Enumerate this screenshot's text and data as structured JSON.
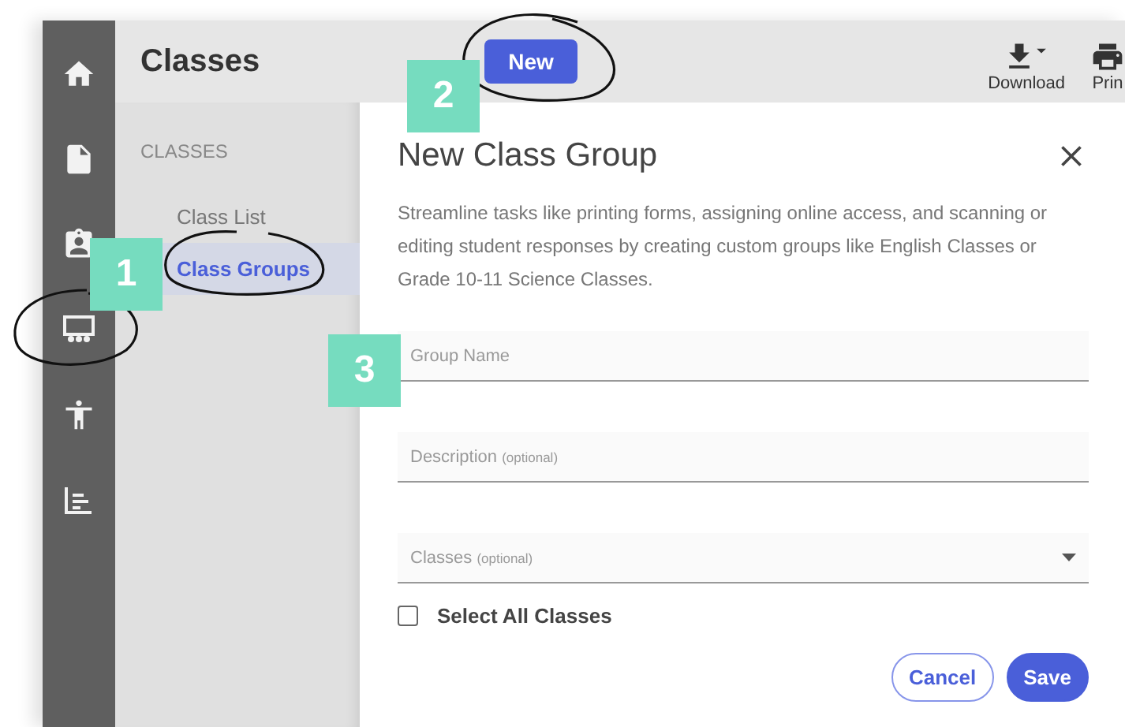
{
  "rail": {
    "items": [
      {
        "kind": "home"
      },
      {
        "kind": "file"
      },
      {
        "kind": "badge"
      },
      {
        "kind": "classes"
      },
      {
        "kind": "person"
      },
      {
        "kind": "chart"
      }
    ]
  },
  "header": {
    "title": "Classes",
    "new_button": "New",
    "actions": [
      {
        "kind": "download",
        "label": "Download"
      },
      {
        "kind": "print",
        "label": "Prin"
      }
    ]
  },
  "nav": {
    "heading": "CLASSES",
    "items": [
      {
        "label": "Class List",
        "selected": false
      },
      {
        "label": "Class Groups",
        "selected": true
      }
    ]
  },
  "dialog": {
    "title": "New Class Group",
    "description": "Streamline tasks like printing forms, assigning online access, and scanning or editing student responses by creating custom groups like English Classes or Grade 10-11 Science Classes.",
    "fields": [
      {
        "kind": "text",
        "placeholder": "Group Name"
      },
      {
        "kind": "text",
        "placeholder": "Description",
        "note": "(optional)"
      },
      {
        "kind": "select",
        "placeholder": "Classes",
        "note": "(optional)"
      }
    ],
    "select_all": {
      "label": "Select All Classes",
      "checked": false
    },
    "buttons": [
      {
        "kind": "secondary",
        "label": "Cancel"
      },
      {
        "kind": "primary",
        "label": "Save"
      }
    ]
  },
  "callouts": [
    {
      "number": "1"
    },
    {
      "number": "2"
    },
    {
      "number": "3"
    }
  ]
}
